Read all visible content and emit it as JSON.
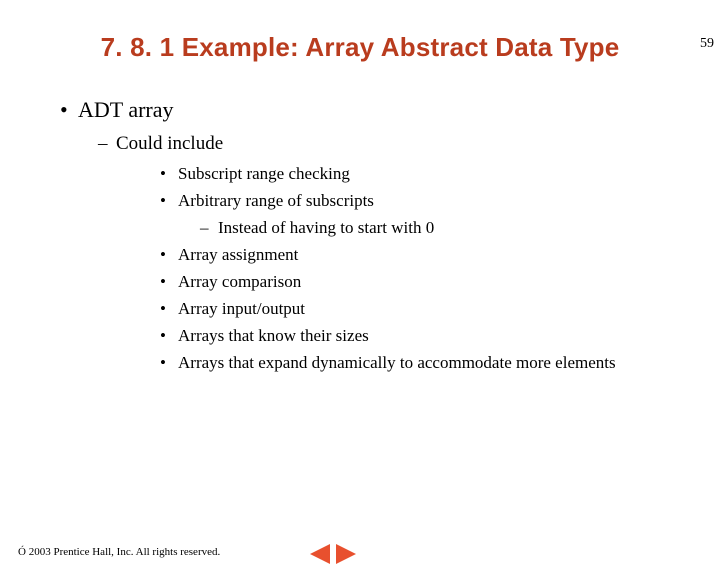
{
  "page_number": "59",
  "title": "7. 8. 1  Example: Array Abstract Data Type",
  "bullets": {
    "lvl1": "ADT array",
    "lvl2": "Could include",
    "items": [
      "Subscript range checking",
      "Arbitrary range of subscripts",
      "Array assignment",
      "Array comparison",
      "Array input/output",
      "Arrays that know their sizes",
      "Arrays that expand dynamically to accommodate more elements"
    ],
    "subitem": "Instead of having to start with 0"
  },
  "copyright": "2003 Prentice Hall, Inc. All rights reserved."
}
